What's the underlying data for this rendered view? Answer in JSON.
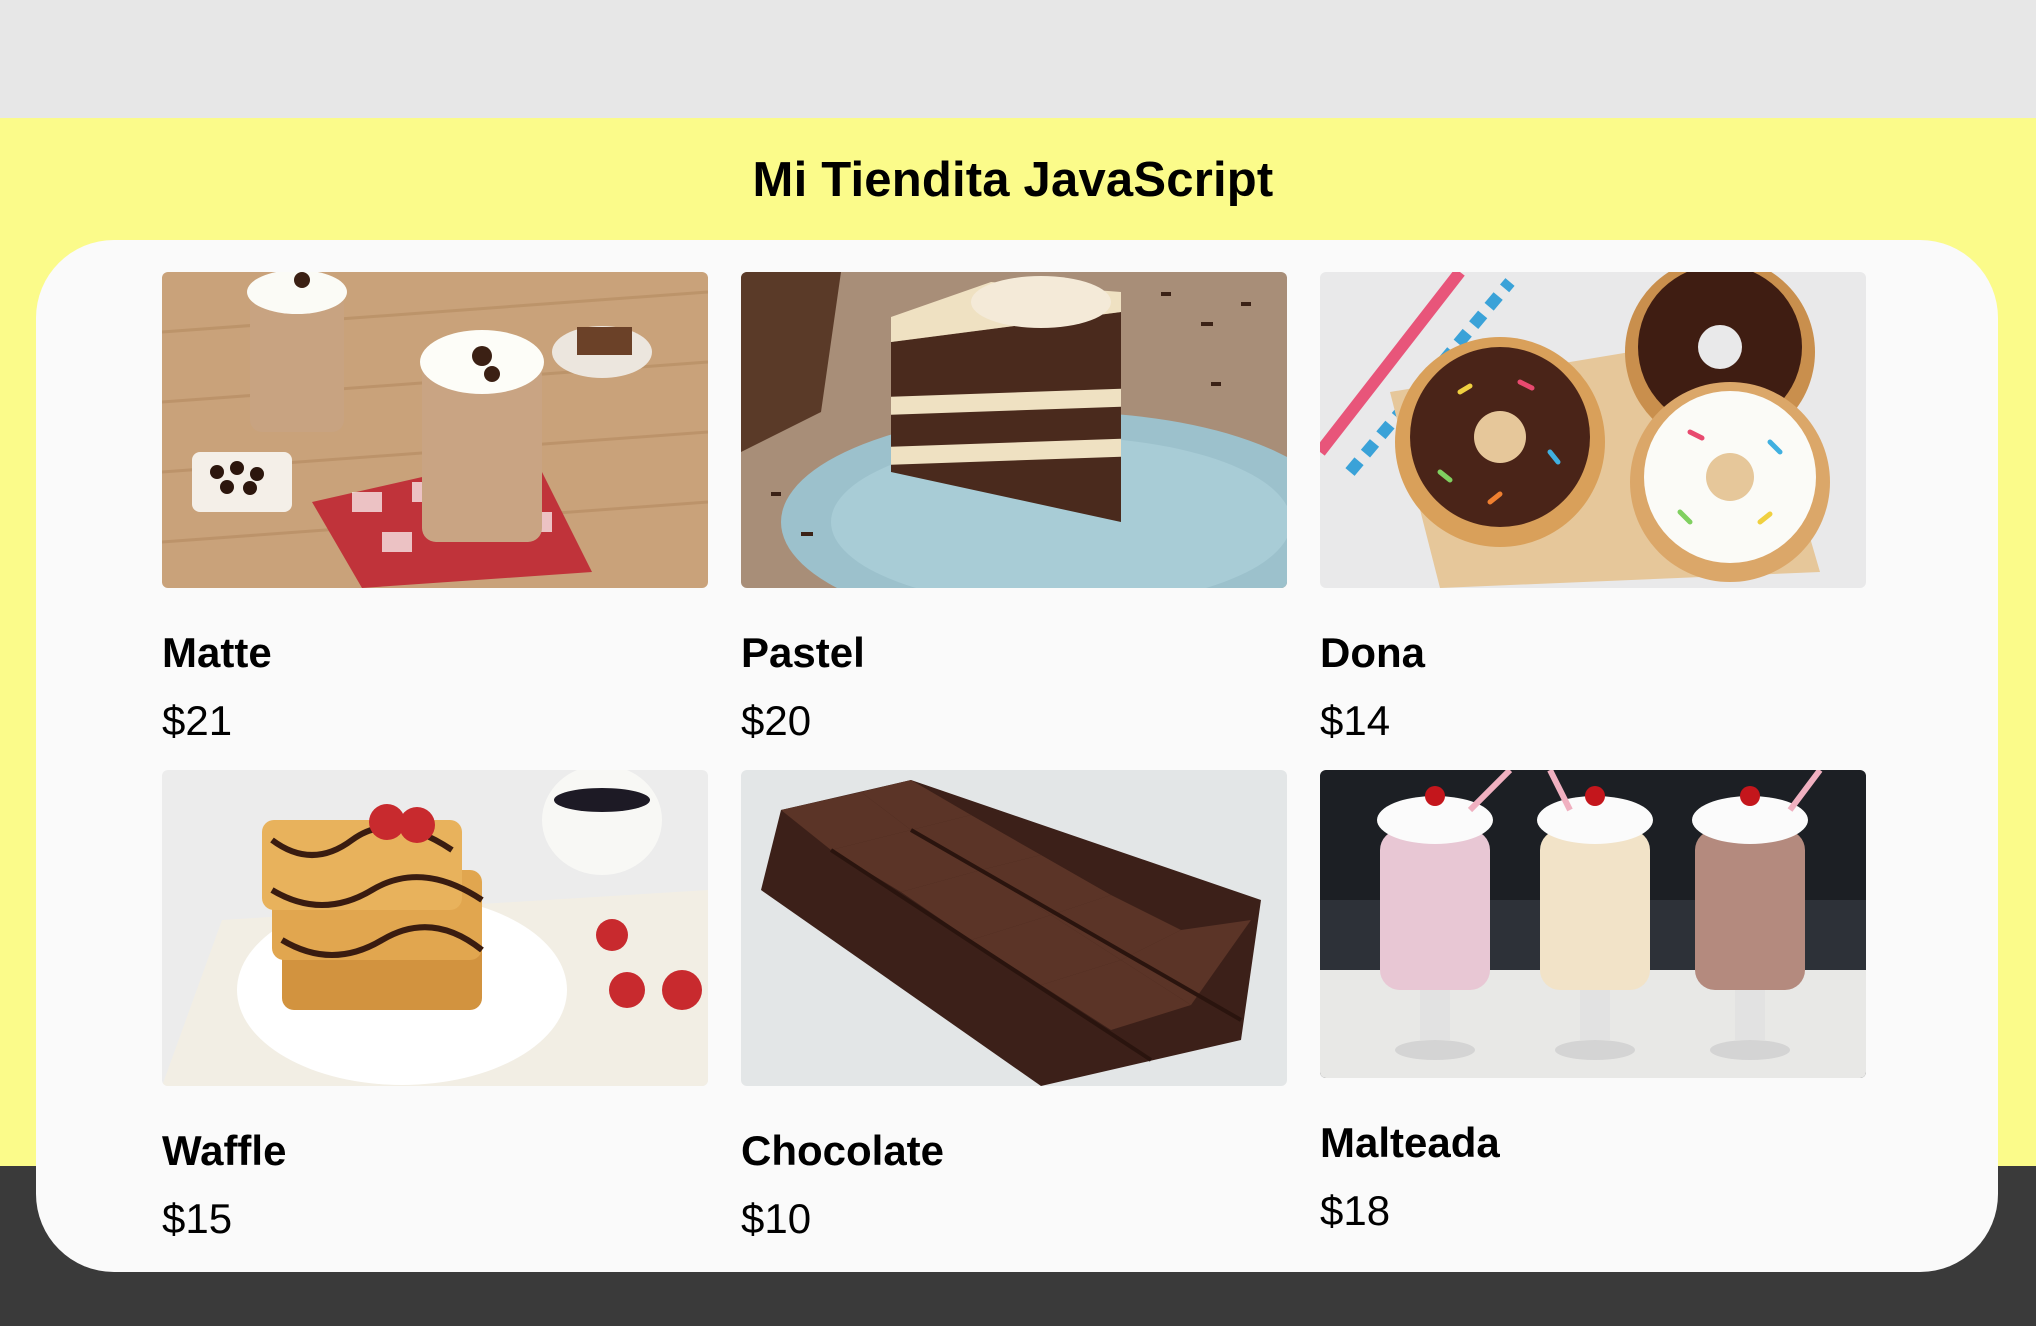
{
  "store": {
    "title": "Mi Tiendita JavaScript"
  },
  "products": [
    {
      "name": "Matte",
      "price": "$21",
      "image": "iced-coffee-photo"
    },
    {
      "name": "Pastel",
      "price": "$20",
      "image": "chocolate-cake-photo"
    },
    {
      "name": "Dona",
      "price": "$14",
      "image": "donuts-photo"
    },
    {
      "name": "Waffle",
      "price": "$15",
      "image": "waffles-photo"
    },
    {
      "name": "Chocolate",
      "price": "$10",
      "image": "chocolate-bar-photo"
    },
    {
      "name": "Malteada",
      "price": "$18",
      "image": "milkshakes-photo"
    }
  ],
  "colors": {
    "header_bg": "#e7e7e7",
    "page_bg": "#fbfb8a",
    "card_bg": "#fafafa",
    "footer_bg": "#3a3a3a",
    "text": "#000000"
  }
}
